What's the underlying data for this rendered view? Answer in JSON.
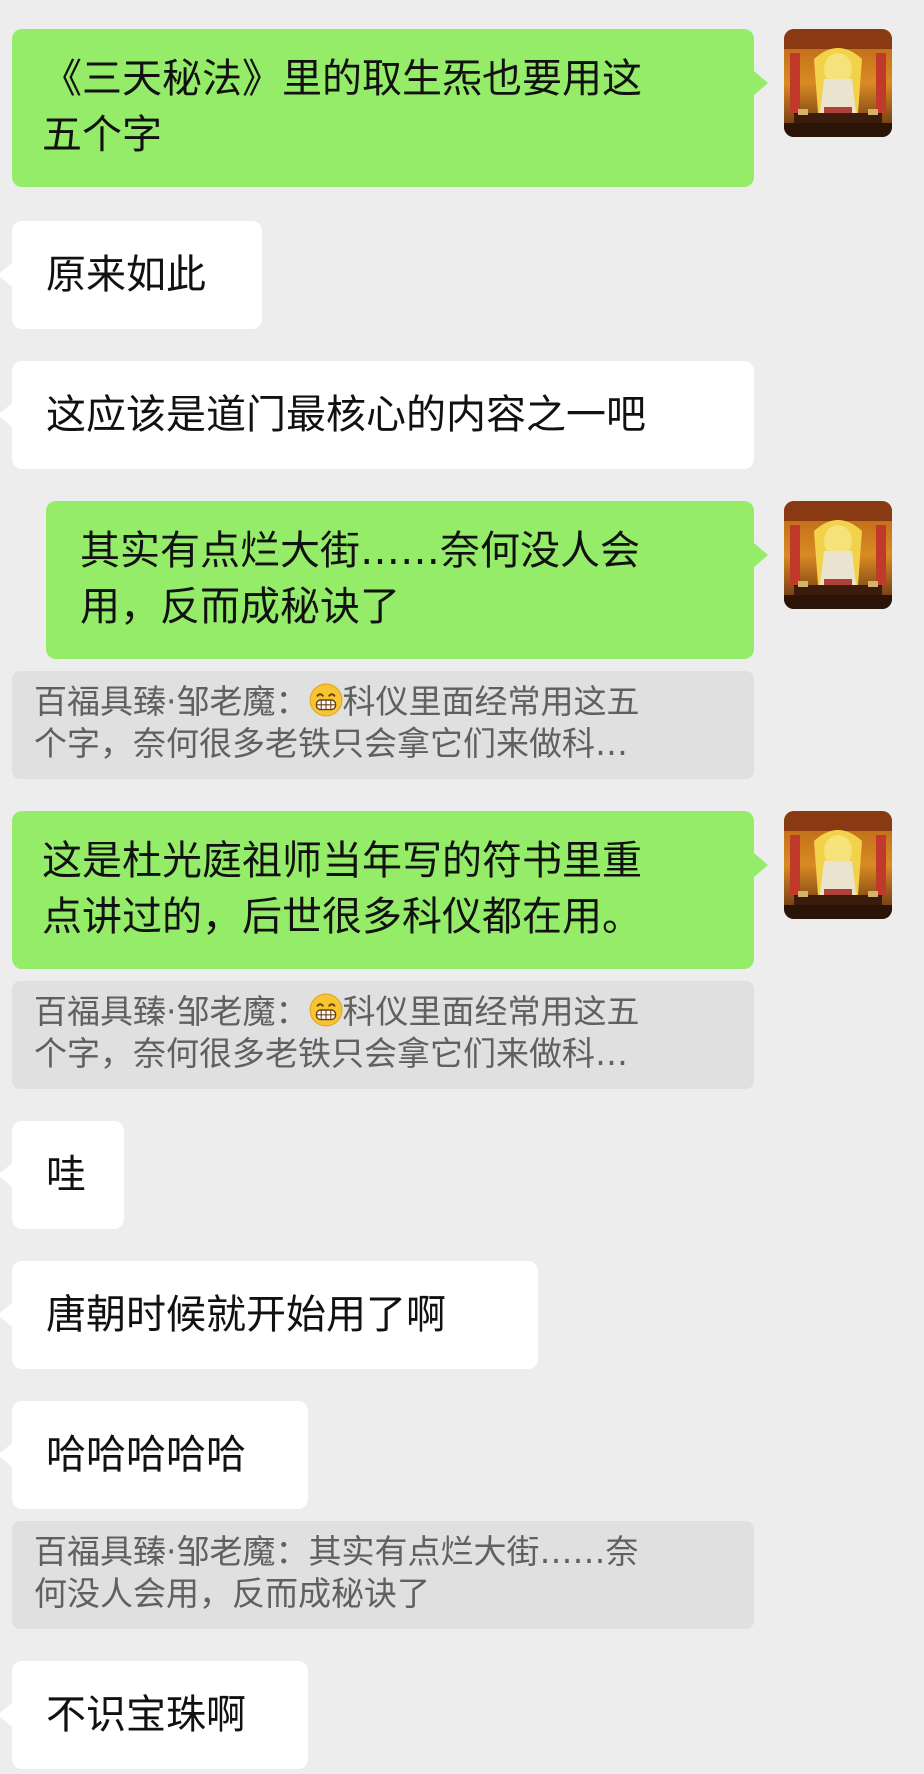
{
  "messages": {
    "m1": {
      "line1": "《三天秘法》里的取生炁也要用这",
      "line2": "五个字"
    },
    "m2": {
      "text": "原来如此"
    },
    "m3": {
      "text": "这应该是道门最核心的内容之一吧"
    },
    "m4": {
      "line1": "其实有点烂大街……奈何没人会",
      "line2": "用，反而成秘诀了"
    },
    "q1": {
      "prefix": "百福具臻·邹老魔：",
      "emoji": "grinning-face-emoji",
      "rest": "科仪里面经常用这五",
      "line2": "个字，奈何很多老铁只会拿它们来做科…"
    },
    "m5": {
      "line1": "这是杜光庭祖师当年写的符书里重",
      "line2": "点讲过的，后世很多科仪都在用。"
    },
    "q2": {
      "prefix": "百福具臻·邹老魔：",
      "emoji": "grinning-face-emoji",
      "rest": "科仪里面经常用这五",
      "line2": "个字，奈何很多老铁只会拿它们来做科…"
    },
    "m6": {
      "text": "哇"
    },
    "m7": {
      "text": "唐朝时候就开始用了啊"
    },
    "m8": {
      "text": "哈哈哈哈哈"
    },
    "q3": {
      "line1": "百福具臻·邹老魔：其实有点烂大街……奈",
      "line2": "何没人会用，反而成秘诀了"
    },
    "m9": {
      "text": "不识宝珠啊"
    }
  },
  "avatar": {
    "icon": "deity-statue-avatar"
  },
  "colors": {
    "self_bubble": "#95ec69",
    "other_bubble": "#ffffff",
    "background": "#ededed",
    "quote_bg": "#e0e0e0"
  }
}
